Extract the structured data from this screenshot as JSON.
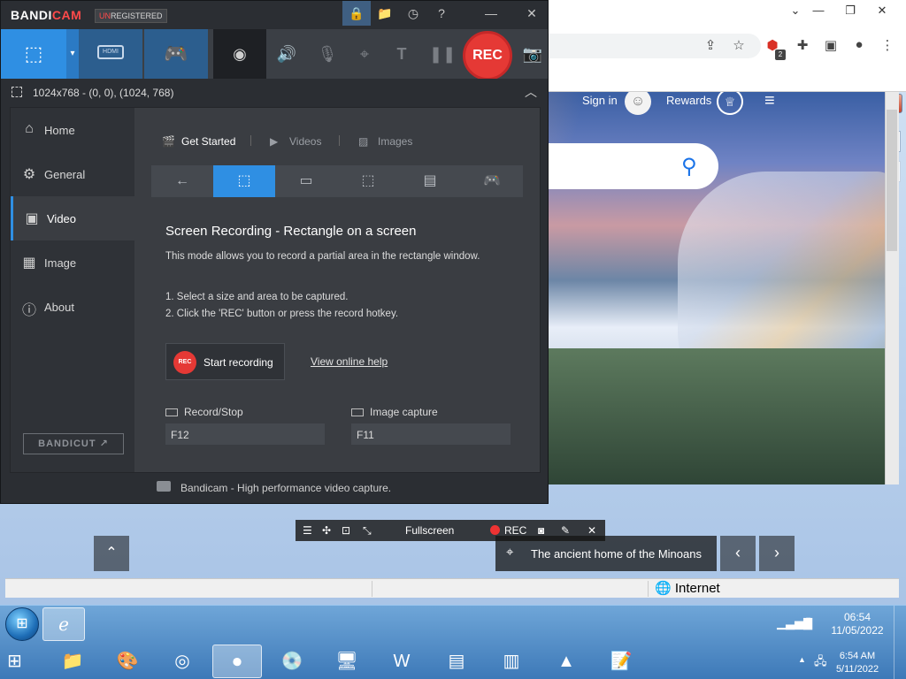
{
  "bandicam": {
    "logo_main": "BANDI",
    "logo_accent": "CAM",
    "unregistered_accent": "UN",
    "unregistered_rest": "REGISTERED",
    "rec_label": "REC",
    "region_text": "1024x768 - (0, 0), (1024, 768)",
    "hdmi_label": "HDMI",
    "sidebar": [
      {
        "label": "Home",
        "icon": "home-icon"
      },
      {
        "label": "General",
        "icon": "gear-icon"
      },
      {
        "label": "Video",
        "icon": "video-settings-icon"
      },
      {
        "label": "Image",
        "icon": "image-icon"
      },
      {
        "label": "About",
        "icon": "info-icon"
      }
    ],
    "bandicut_label": "BANDICUT",
    "tabs": [
      {
        "label": "Get Started"
      },
      {
        "label": "Videos"
      },
      {
        "label": "Images"
      }
    ],
    "heading": "Screen Recording - Rectangle on a screen",
    "description": "This mode allows you to record a partial area in the rectangle window.",
    "step1": "1. Select a size and area to be captured.",
    "step2": "2. Click the 'REC' button or press the record hotkey.",
    "start_recording": "Start recording",
    "rec_small": "REC",
    "online_help": "View online help",
    "hotkeys": {
      "record_stop_label": "Record/Stop",
      "record_stop_value": "F12",
      "image_capture_label": "Image capture",
      "image_capture_value": "F11"
    },
    "status": "Bandicam - High performance video capture.",
    "colors": {
      "accent": "#2f8fe3",
      "rec": "#e53935",
      "background": "#2b2e33"
    }
  },
  "bing": {
    "sign_in": "Sign in",
    "rewards": "Rewards",
    "caption": "The ancient home of the Minoans"
  },
  "mini_toolbar": {
    "mode": "Fullscreen",
    "rec": "REC"
  },
  "ie": {
    "zone": "Internet"
  },
  "chrome": {
    "extension_badge": "2"
  },
  "taskbar": {
    "time_top": "06:54",
    "date_top": "11/05/2022",
    "time_bottom": "6:54 AM",
    "date_bottom": "5/11/2022"
  }
}
